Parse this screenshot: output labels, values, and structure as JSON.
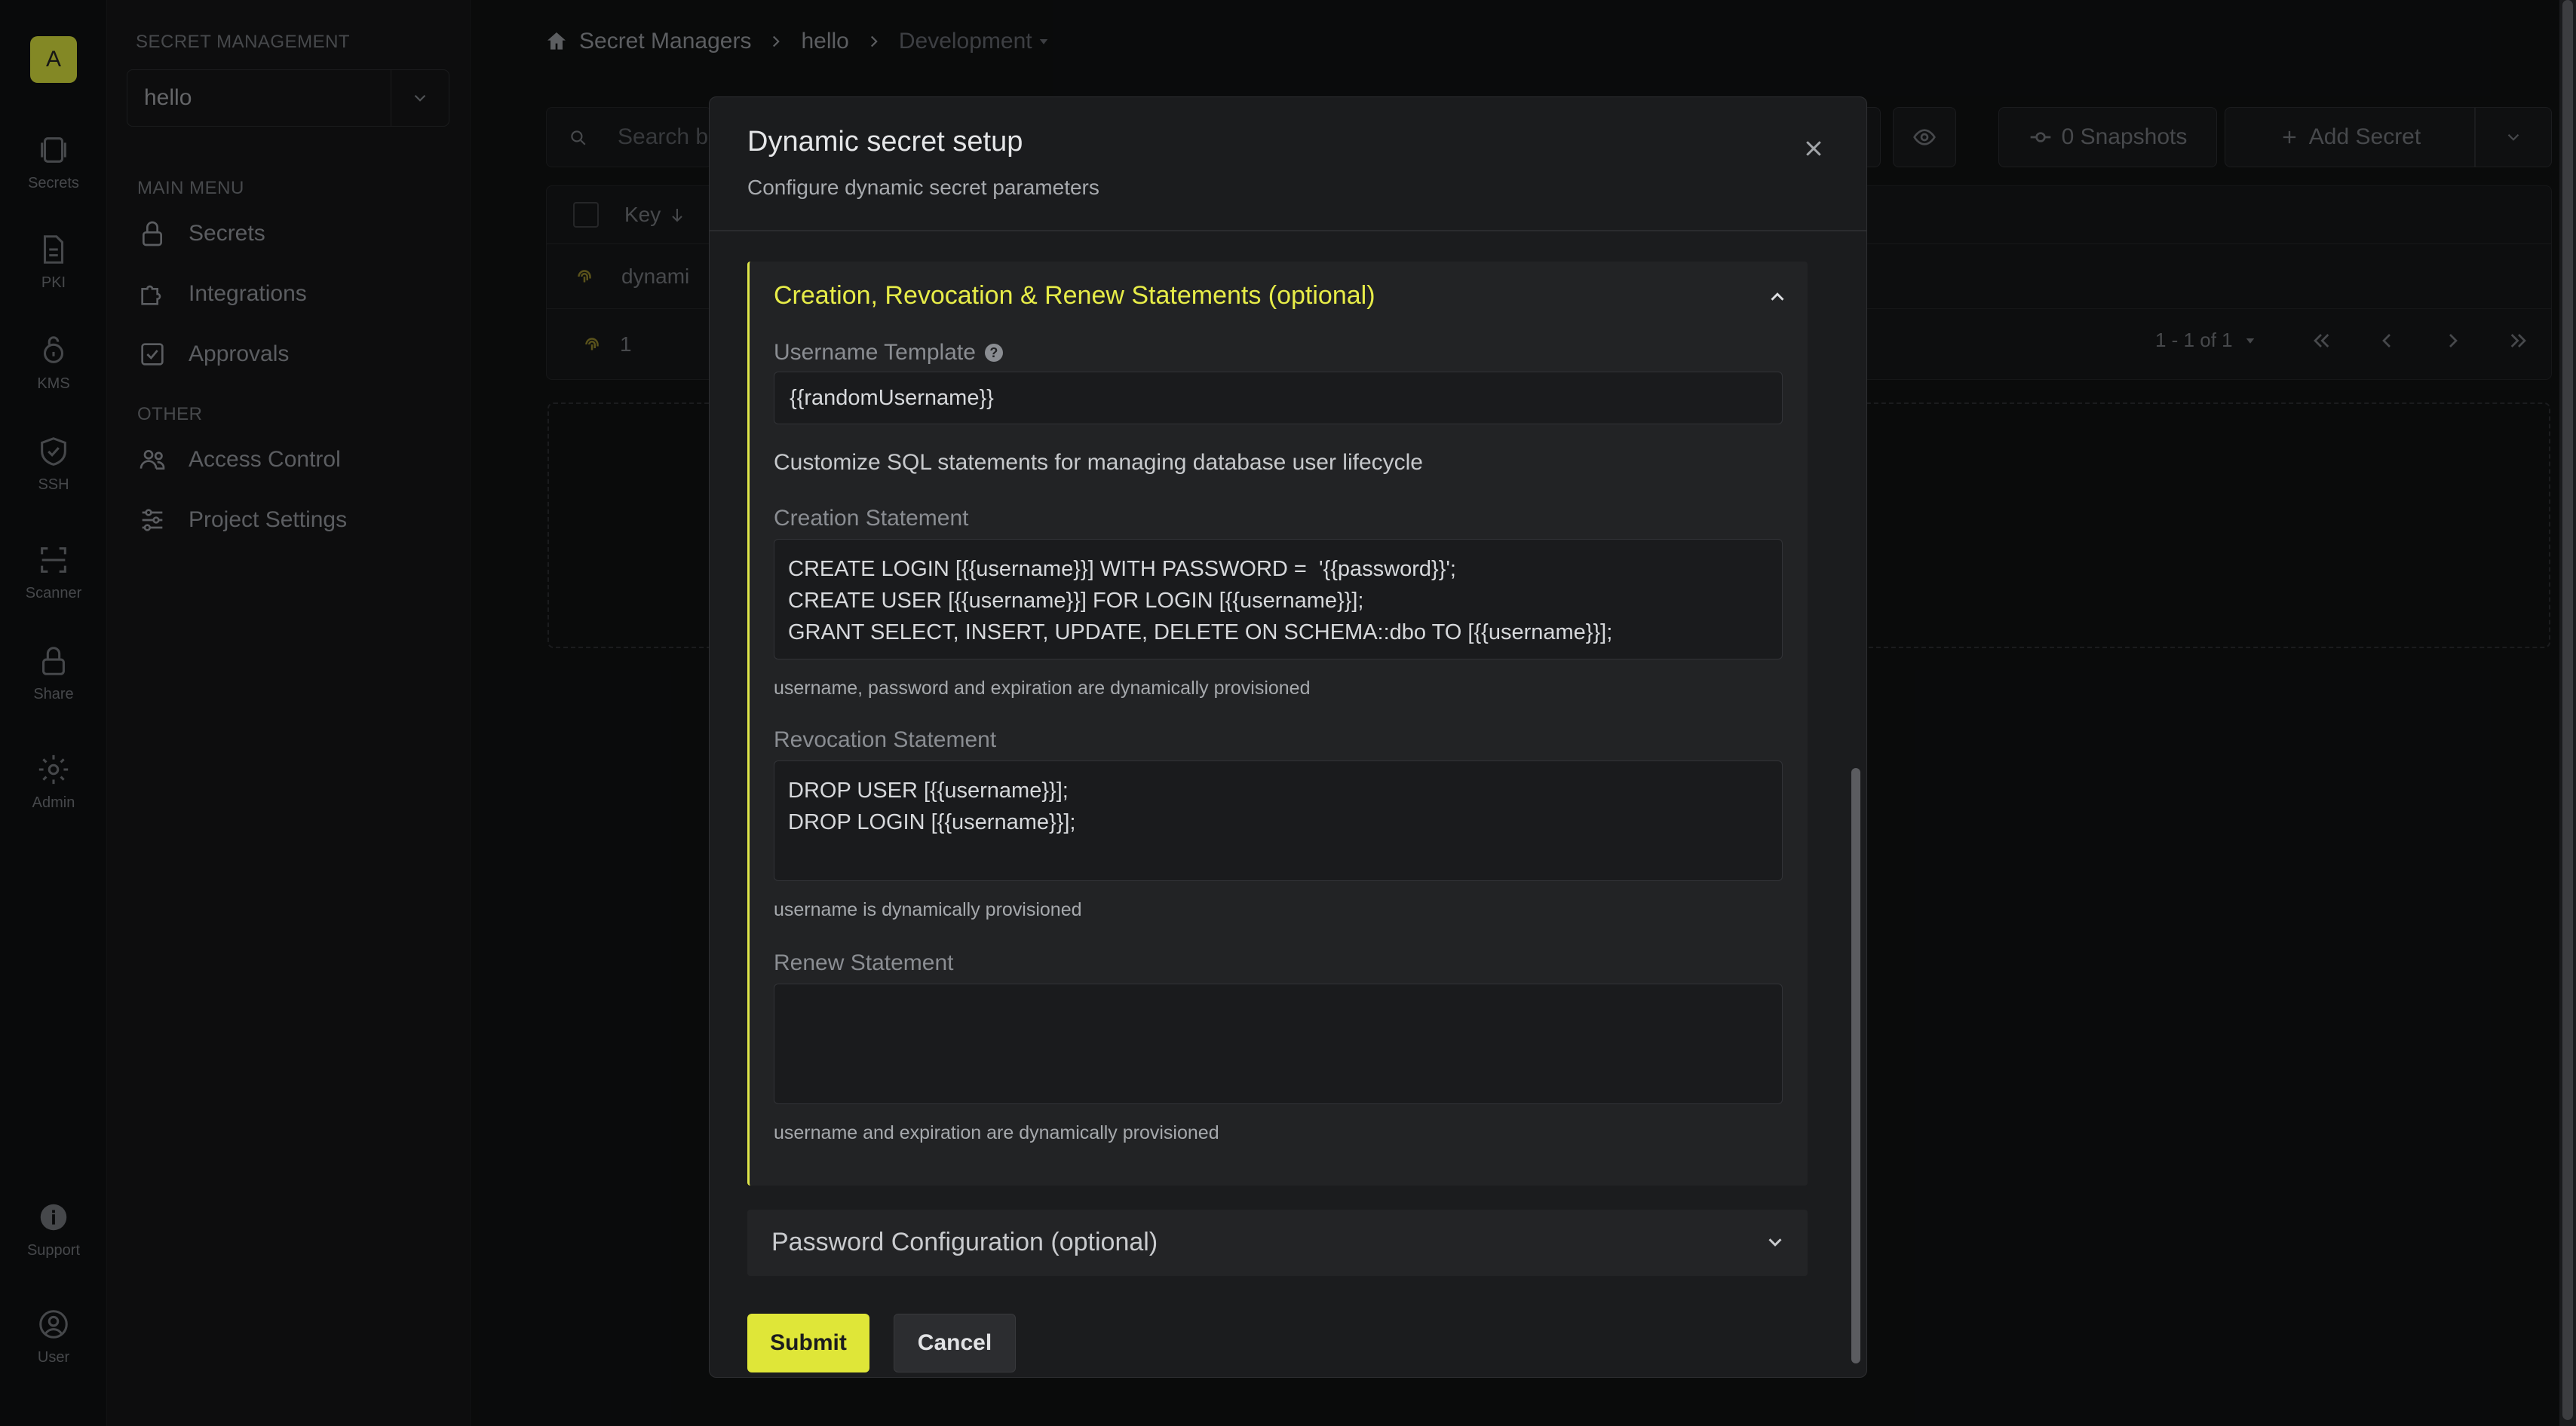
{
  "org_initial": "A",
  "rail": [
    {
      "label": "Secrets",
      "icon": "vault-icon"
    },
    {
      "label": "PKI",
      "icon": "certificate-icon"
    },
    {
      "label": "KMS",
      "icon": "key-lock-icon"
    },
    {
      "label": "SSH",
      "icon": "shield-check-icon"
    },
    {
      "label": "Scanner",
      "icon": "scan-icon"
    },
    {
      "label": "Share",
      "icon": "lock-icon"
    },
    {
      "label": "Admin",
      "icon": "gear-icon"
    }
  ],
  "rail_bottom": [
    {
      "label": "Support",
      "icon": "info-icon"
    },
    {
      "label": "User",
      "icon": "user-icon"
    }
  ],
  "sidebar": {
    "section_heading": "SECRET MANAGEMENT",
    "project": "hello",
    "main_menu_heading": "MAIN MENU",
    "main_items": [
      {
        "label": "Secrets",
        "icon": "lock-icon"
      },
      {
        "label": "Integrations",
        "icon": "puzzle-icon"
      },
      {
        "label": "Approvals",
        "icon": "checkbox-icon"
      }
    ],
    "other_heading": "OTHER",
    "other_items": [
      {
        "label": "Access Control",
        "icon": "users-icon"
      },
      {
        "label": "Project Settings",
        "icon": "sliders-icon"
      }
    ]
  },
  "breadcrumb": {
    "root": "Secret Managers",
    "project": "hello",
    "environment": "Development"
  },
  "main": {
    "search_placeholder": "Search b",
    "snapshots_label": "0 Snapshots",
    "add_secret_label": "Add Secret",
    "table_header_key": "Key",
    "row_key": "dynami",
    "folder_count": "1",
    "pagination": "1 - 1 of 1"
  },
  "modal": {
    "title": "Dynamic secret setup",
    "subtitle": "Configure dynamic secret parameters",
    "statements_section": {
      "title": "Creation, Revocation & Renew Statements (optional)",
      "username_template_label": "Username Template",
      "username_template_value": "{{randomUsername}}",
      "description": "Customize SQL statements for managing database user lifecycle",
      "creation_label": "Creation Statement",
      "creation_value": "CREATE LOGIN [{{username}}] WITH PASSWORD =  '{{password}}';\nCREATE USER [{{username}}] FOR LOGIN [{{username}}];\nGRANT SELECT, INSERT, UPDATE, DELETE ON SCHEMA::dbo TO [{{username}}];",
      "creation_helper": "username, password and expiration are dynamically provisioned",
      "revocation_label": "Revocation Statement",
      "revocation_value": "DROP USER [{{username}}];\nDROP LOGIN [{{username}}];",
      "revocation_helper": "username is dynamically provisioned",
      "renew_label": "Renew Statement",
      "renew_value": "",
      "renew_helper": "username and expiration are dynamically provisioned"
    },
    "password_section_title": "Password Configuration (optional)",
    "submit_label": "Submit",
    "cancel_label": "Cancel"
  },
  "colors": {
    "accent": "#dfe638",
    "background": "#101112",
    "modal": "#1b1c1e"
  }
}
